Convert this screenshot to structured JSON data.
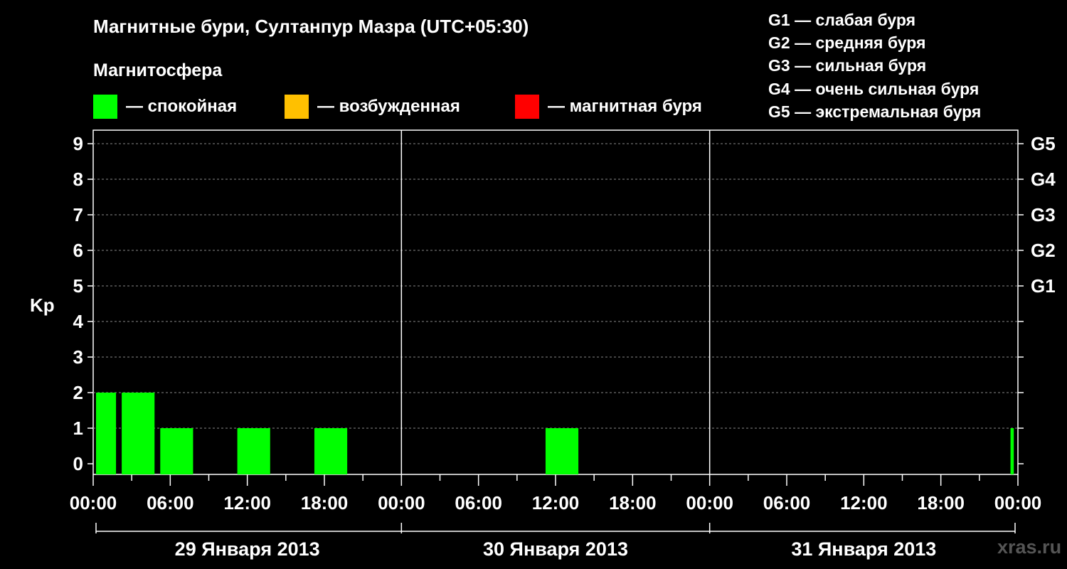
{
  "title": "Магнитные бури, Султанпур Мазра (UTC+05:30)",
  "subtitle": "Магнитосфера",
  "legend": [
    {
      "label": "— спокойная",
      "color": "#00ff00"
    },
    {
      "label": "— возбужденная",
      "color": "#ffc000"
    },
    {
      "label": "— магнитная буря",
      "color": "#ff0000"
    }
  ],
  "g_scale": [
    "G1 — слабая буря",
    "G2 — средняя буря",
    "G3 — сильная буря",
    "G4 — очень сильная буря",
    "G5 — экстремальная буря"
  ],
  "watermark": "xras.ru",
  "chart_data": {
    "type": "bar",
    "ylabel": "Kp",
    "ylim": [
      0,
      9
    ],
    "yticks": [
      "0",
      "1",
      "2",
      "3",
      "4",
      "5",
      "6",
      "7",
      "8",
      "9"
    ],
    "right_ticks": [
      {
        "kp": 5,
        "label": "G1"
      },
      {
        "kp": 6,
        "label": "G2"
      },
      {
        "kp": 7,
        "label": "G3"
      },
      {
        "kp": 8,
        "label": "G4"
      },
      {
        "kp": 9,
        "label": "G5"
      }
    ],
    "xlim_hours": [
      0,
      72
    ],
    "xtick_labels": [
      "00:00",
      "06:00",
      "12:00",
      "18:00",
      "00:00",
      "06:00",
      "12:00",
      "18:00",
      "00:00",
      "06:00",
      "12:00",
      "18:00",
      "00:00"
    ],
    "days": [
      "29 Января 2013",
      "30 Января 2013",
      "31 Января 2013"
    ],
    "grid": "dashed horizontal at each Kp level",
    "bars": [
      {
        "start": 0,
        "end": 2,
        "kp": 2,
        "color": "#00ff00"
      },
      {
        "start": 2,
        "end": 5,
        "kp": 2,
        "color": "#00ff00"
      },
      {
        "start": 5,
        "end": 8,
        "kp": 1,
        "color": "#00ff00"
      },
      {
        "start": 11,
        "end": 14,
        "kp": 1,
        "color": "#00ff00"
      },
      {
        "start": 17,
        "end": 20,
        "kp": 1,
        "color": "#00ff00"
      },
      {
        "start": 35,
        "end": 38,
        "kp": 1,
        "color": "#00ff00"
      },
      {
        "start": 71.2,
        "end": 71.9,
        "kp": 1,
        "color": "#00ff00"
      }
    ]
  }
}
